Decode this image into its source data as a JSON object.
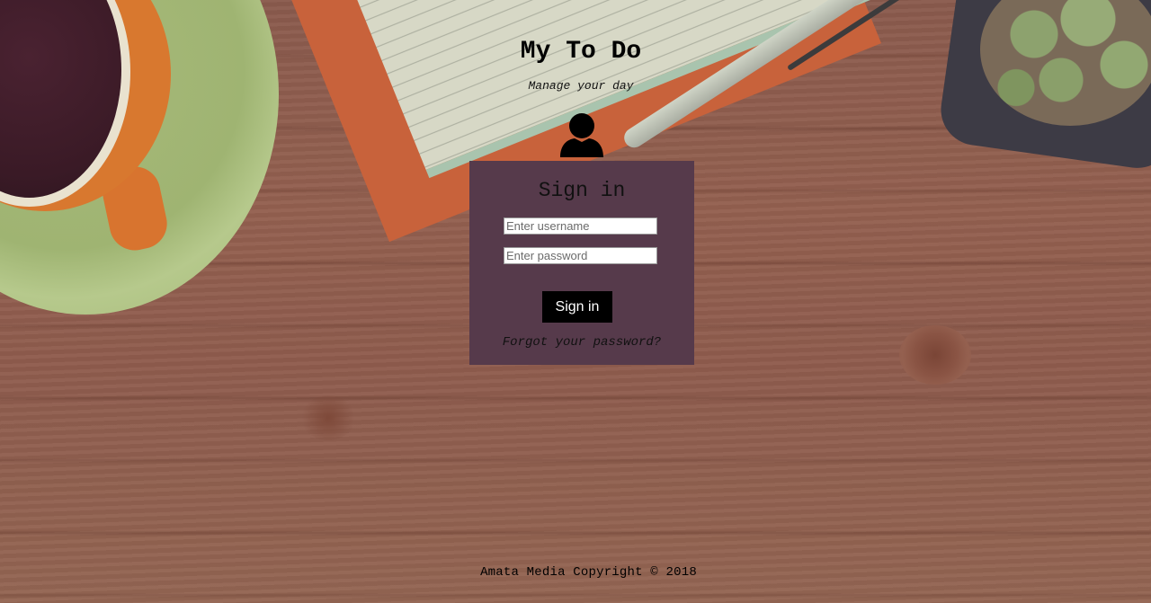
{
  "header": {
    "title": "My To Do",
    "subtitle": "Manage your day"
  },
  "login": {
    "heading": "Sign in",
    "username_placeholder": "Enter username",
    "password_placeholder": "Enter password",
    "submit_label": "Sign in",
    "forgot_link": "Forgot your password?"
  },
  "footer": {
    "text": "Amata Media Copyright © 2018"
  },
  "icons": {
    "user": "user-icon"
  },
  "colors": {
    "panel_background": "#563a4b",
    "button_background": "#000000",
    "button_text": "#ffffff"
  }
}
